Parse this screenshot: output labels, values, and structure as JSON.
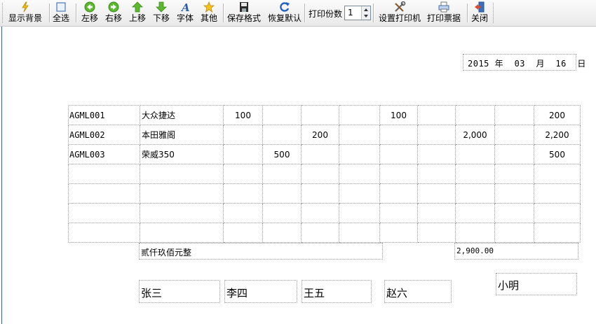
{
  "toolbar": {
    "show_background": "显示背景",
    "select_all": "全选",
    "move_left": "左移",
    "move_right": "右移",
    "move_up": "上移",
    "move_down": "下移",
    "font": "字体",
    "other": "其他",
    "save_format": "保存格式",
    "restore_default": "恢复默认",
    "copies_label": "打印份数",
    "copies_value": "1",
    "printer_setup": "设置打印机",
    "print_ticket": "打印票据",
    "close": "关闭"
  },
  "date": "2015 年  03  月  16  日",
  "rows": [
    {
      "code": "AGML001",
      "name": "大众捷达",
      "c1": "100",
      "c2": "",
      "c3": "",
      "c4": "",
      "c5": "100",
      "c6": "",
      "c7": "",
      "c8": "",
      "total": "200"
    },
    {
      "code": "AGML002",
      "name": "本田雅阁",
      "c1": "",
      "c2": "",
      "c3": "200",
      "c4": "",
      "c5": "",
      "c6": "",
      "c7": "2,000",
      "c8": "",
      "total": "2,200"
    },
    {
      "code": "AGML003",
      "name": "荣威350",
      "c1": "",
      "c2": "500",
      "c3": "",
      "c4": "",
      "c5": "",
      "c6": "",
      "c7": "",
      "c8": "",
      "total": "500"
    }
  ],
  "summary": {
    "amount_words": "贰仟玖佰元整",
    "amount_value": "2,900.00"
  },
  "signatures": [
    "张三",
    "李四",
    "王五",
    "赵六",
    "小明"
  ]
}
